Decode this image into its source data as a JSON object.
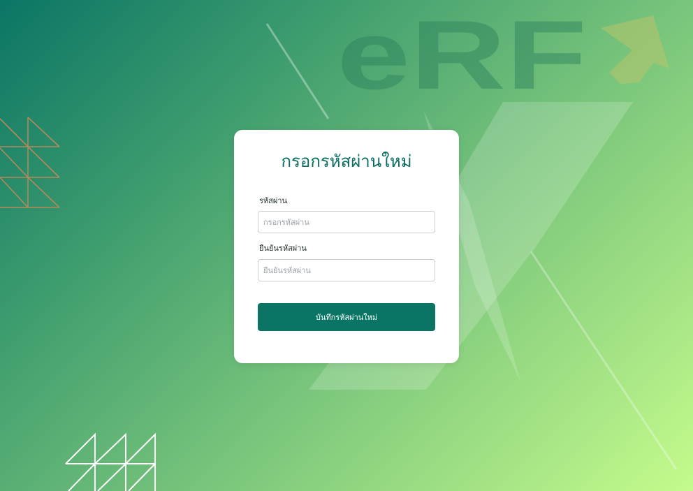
{
  "brand": {
    "logo_text": "eRF"
  },
  "form": {
    "title": "กรอกรหัสผ่านใหม่",
    "password_label": "รหัสผ่าน",
    "password_placeholder": "กรอกรหัสผ่าน",
    "password_value": "",
    "confirm_label": "ยืนยันรหัสผ่าน",
    "confirm_placeholder": "ยืนยันรหัสผ่าน",
    "confirm_value": "",
    "submit_label": "บันทึกรหัสผ่านใหม่"
  },
  "colors": {
    "accent": "#0b7565",
    "title": "#0b6e63",
    "background_start": "#0b7565",
    "background_end": "#c5fb8c",
    "triangle_pattern": "#b5895a"
  }
}
